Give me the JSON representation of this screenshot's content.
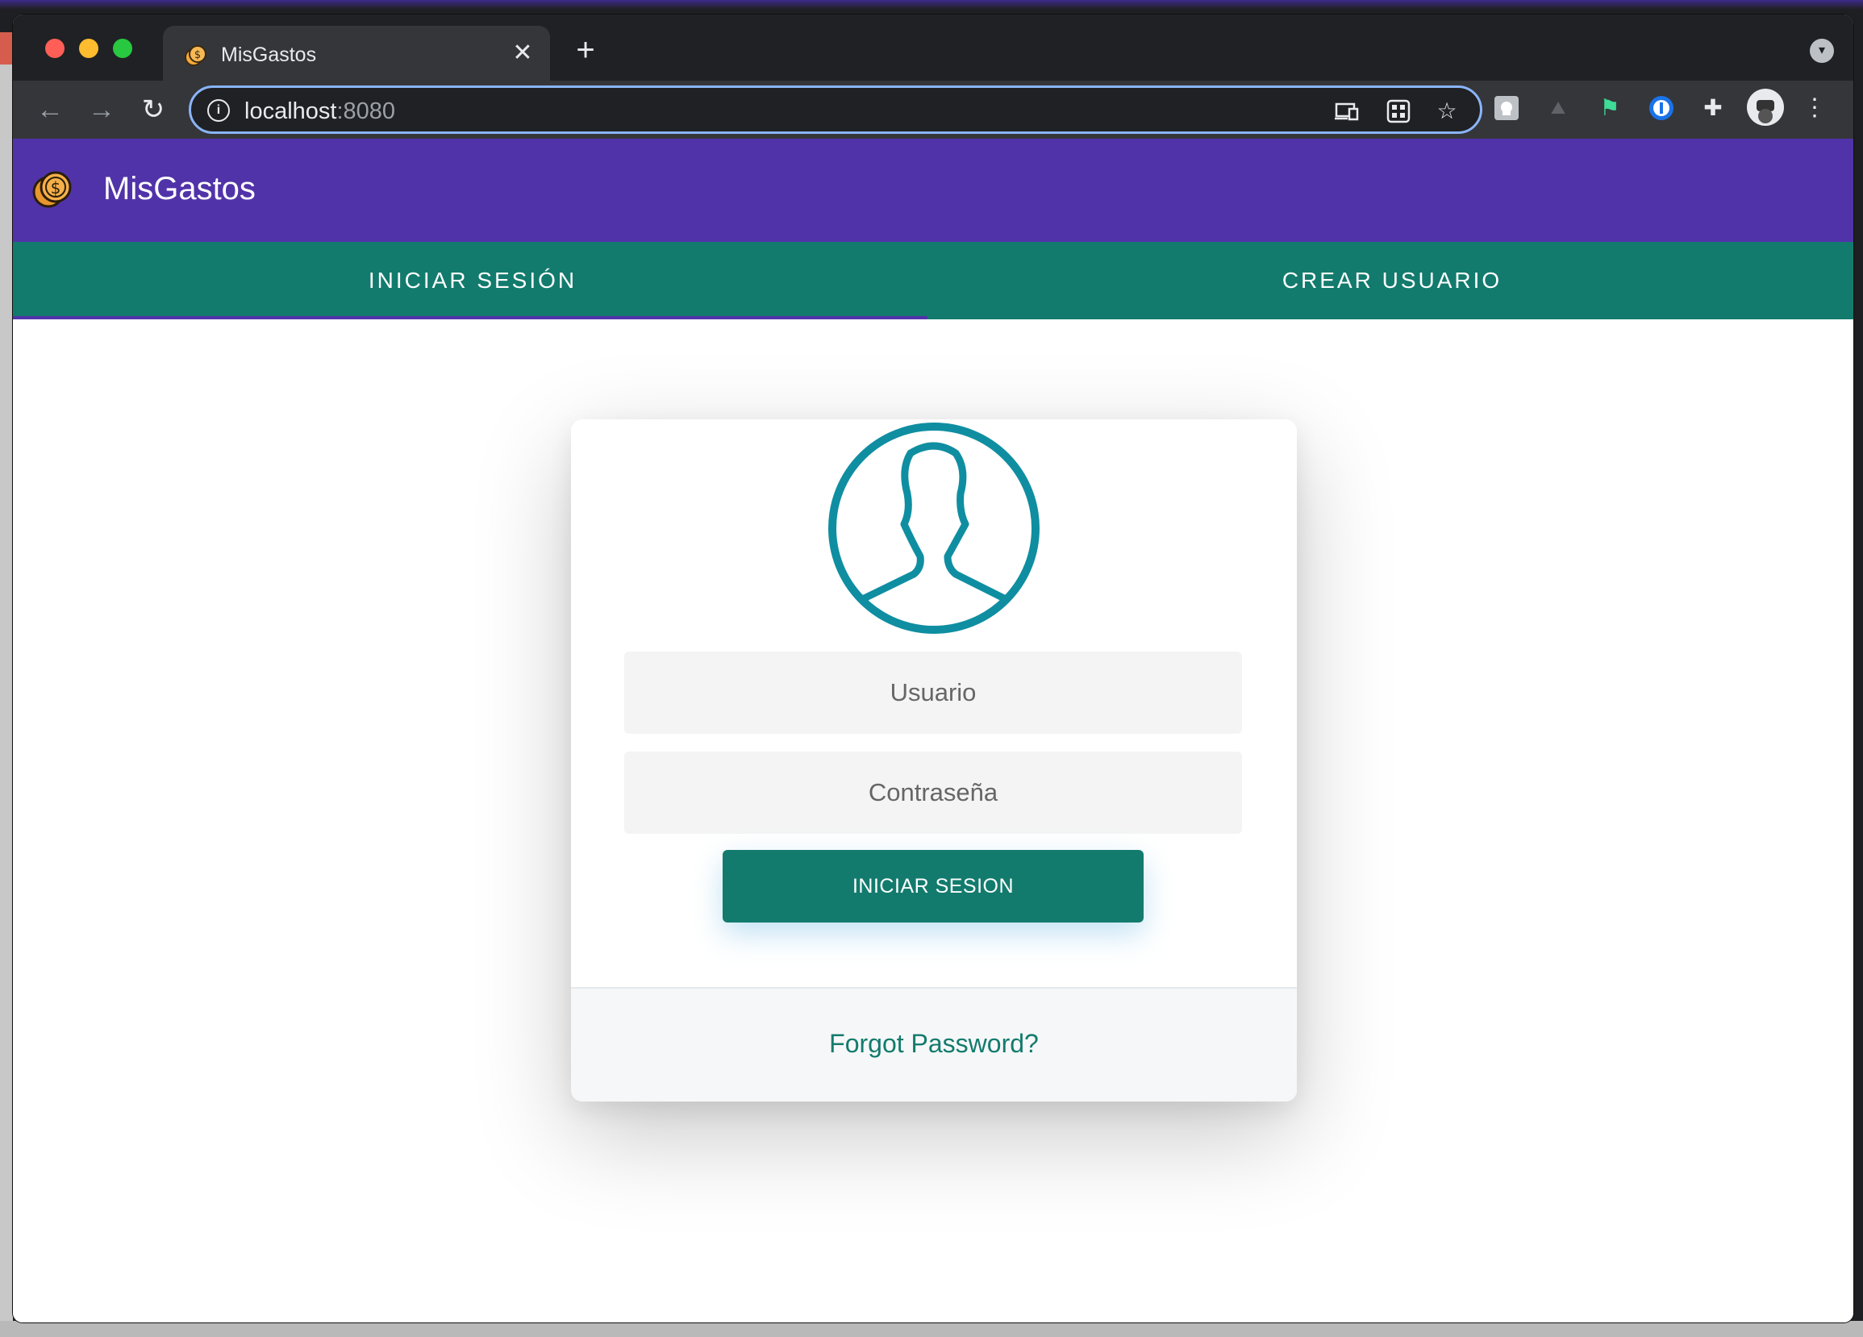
{
  "browser": {
    "tab_title": "MisGastos",
    "tab_close": "✕",
    "new_tab": "+",
    "url_host": "localhost",
    "url_port": ":8080",
    "back": "←",
    "forward": "→",
    "reload": "↻",
    "icons": [
      "cast-icon",
      "grid-icon",
      "star-icon",
      "extension-square-icon",
      "mountains-icon",
      "bird-icon",
      "password-manager-icon",
      "puzzle-icon",
      "profile-avatar-icon",
      "kebab-menu-icon"
    ]
  },
  "app": {
    "title": "MisGastos",
    "colors": {
      "appbar": "#5133a9",
      "tabs": "#127b6d",
      "accent": "#127b6d",
      "avatar": "#0f8ea1"
    }
  },
  "tabs": [
    {
      "label": "INICIAR SESIÓN",
      "active": true
    },
    {
      "label": "CREAR USUARIO",
      "active": false
    }
  ],
  "login": {
    "username_placeholder": "Usuario",
    "password_placeholder": "Contraseña",
    "submit_label": "INICIAR SESION",
    "forgot_label": "Forgot Password?"
  }
}
